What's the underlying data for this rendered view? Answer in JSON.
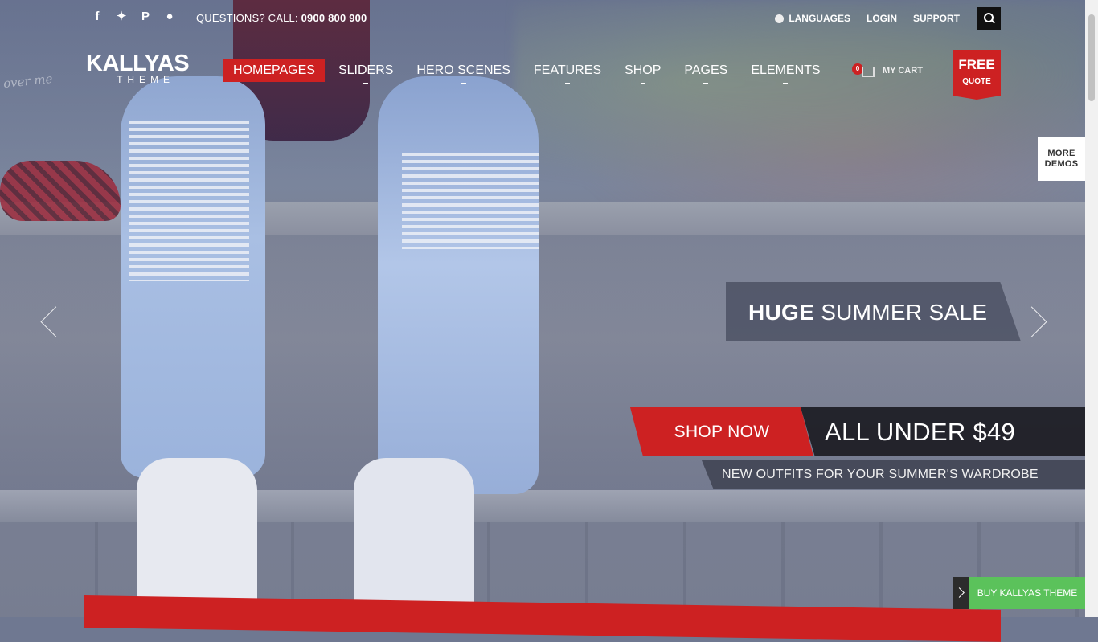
{
  "topbar": {
    "social_icons": [
      "facebook-icon",
      "twitter-icon",
      "pinterest-icon",
      "blog-icon"
    ],
    "questions_label": "QUESTIONS? CALL: ",
    "phone": "0900 800 900",
    "languages": "LANGUAGES",
    "login": "LOGIN",
    "support": "SUPPORT"
  },
  "logo": {
    "main": "KALLYAS",
    "sub": "THEME"
  },
  "nav": {
    "items": [
      {
        "label": "HOMEPAGES",
        "active": true
      },
      {
        "label": "SLIDERS",
        "active": false
      },
      {
        "label": "HERO SCENES",
        "active": false
      },
      {
        "label": "FEATURES",
        "active": false
      },
      {
        "label": "SHOP",
        "active": false
      },
      {
        "label": "PAGES",
        "active": false
      },
      {
        "label": "ELEMENTS",
        "active": false
      }
    ]
  },
  "cart": {
    "count": "0",
    "label": "MY CART"
  },
  "free_quote": {
    "line1": "FREE",
    "line2": "QUOTE"
  },
  "more_demos": {
    "line1": "MORE",
    "line2": "DEMOS"
  },
  "hero": {
    "caption_bold": "HUGE",
    "caption_rest": " SUMMER SALE",
    "shop_now": "SHOP NOW",
    "price_text": "ALL UNDER $49",
    "subtext": "NEW OUTFITS FOR YOUR SUMMER'S WARDROBE",
    "photo_text": "over me"
  },
  "buy_theme": {
    "label": "BUY KALLYAS THEME"
  },
  "colors": {
    "accent": "#cd2122",
    "buy_green": "#5bc25b",
    "dark": "#111111"
  }
}
